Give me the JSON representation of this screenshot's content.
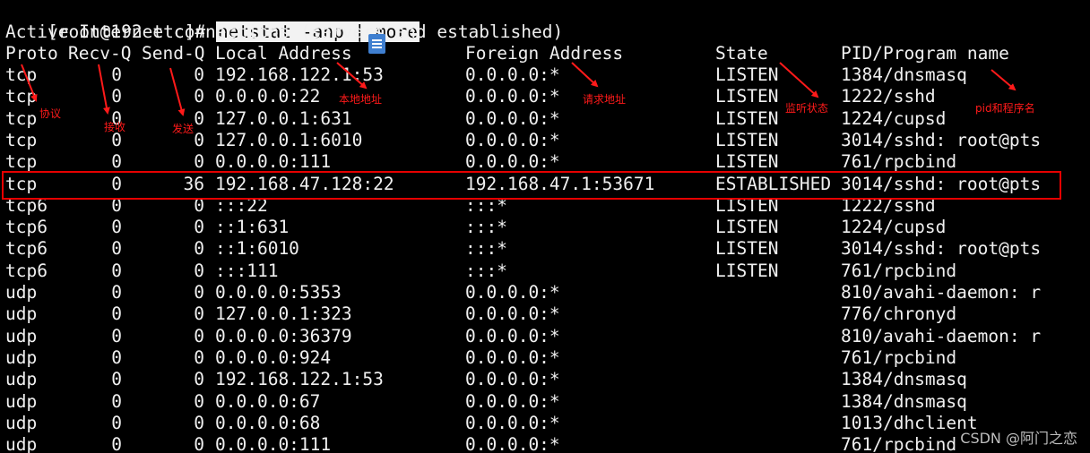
{
  "terminal": {
    "prompt": "[root@192 etc]# ",
    "command": "netstat -anp | more",
    "intro": "Active Internet connections (servers and established)",
    "headers": {
      "proto": "Proto",
      "recvq": "Recv-Q",
      "sendq": "Send-Q",
      "local": "Local Address",
      "foreign": "Foreign Address",
      "state": "State",
      "pid": "PID/Program name"
    },
    "rows": [
      {
        "proto": "tcp",
        "recvq": "0",
        "sendq": "0",
        "local": "192.168.122.1:53",
        "foreign": "0.0.0.0:*",
        "state": "LISTEN",
        "pid": "1384/dnsmasq"
      },
      {
        "proto": "tcp",
        "recvq": "0",
        "sendq": "0",
        "local": "0.0.0.0:22",
        "foreign": "0.0.0.0:*",
        "state": "LISTEN",
        "pid": "1222/sshd"
      },
      {
        "proto": "tcp",
        "recvq": "0",
        "sendq": "0",
        "local": "127.0.0.1:631",
        "foreign": "0.0.0.0:*",
        "state": "LISTEN",
        "pid": "1224/cupsd"
      },
      {
        "proto": "tcp",
        "recvq": "0",
        "sendq": "0",
        "local": "127.0.0.1:6010",
        "foreign": "0.0.0.0:*",
        "state": "LISTEN",
        "pid": "3014/sshd: root@pts"
      },
      {
        "proto": "tcp",
        "recvq": "0",
        "sendq": "0",
        "local": "0.0.0.0:111",
        "foreign": "0.0.0.0:*",
        "state": "LISTEN",
        "pid": "761/rpcbind"
      },
      {
        "proto": "tcp",
        "recvq": "0",
        "sendq": "36",
        "local": "192.168.47.128:22",
        "foreign": "192.168.47.1:53671",
        "state": "ESTABLISHED",
        "pid": "3014/sshd: root@pts"
      },
      {
        "proto": "tcp6",
        "recvq": "0",
        "sendq": "0",
        "local": ":::22",
        "foreign": ":::*",
        "state": "LISTEN",
        "pid": "1222/sshd"
      },
      {
        "proto": "tcp6",
        "recvq": "0",
        "sendq": "0",
        "local": "::1:631",
        "foreign": ":::*",
        "state": "LISTEN",
        "pid": "1224/cupsd"
      },
      {
        "proto": "tcp6",
        "recvq": "0",
        "sendq": "0",
        "local": "::1:6010",
        "foreign": ":::*",
        "state": "LISTEN",
        "pid": "3014/sshd: root@pts"
      },
      {
        "proto": "tcp6",
        "recvq": "0",
        "sendq": "0",
        "local": ":::111",
        "foreign": ":::*",
        "state": "LISTEN",
        "pid": "761/rpcbind"
      },
      {
        "proto": "udp",
        "recvq": "0",
        "sendq": "0",
        "local": "0.0.0.0:5353",
        "foreign": "0.0.0.0:*",
        "state": "",
        "pid": "810/avahi-daemon: r"
      },
      {
        "proto": "udp",
        "recvq": "0",
        "sendq": "0",
        "local": "127.0.0.1:323",
        "foreign": "0.0.0.0:*",
        "state": "",
        "pid": "776/chronyd"
      },
      {
        "proto": "udp",
        "recvq": "0",
        "sendq": "0",
        "local": "0.0.0.0:36379",
        "foreign": "0.0.0.0:*",
        "state": "",
        "pid": "810/avahi-daemon: r"
      },
      {
        "proto": "udp",
        "recvq": "0",
        "sendq": "0",
        "local": "0.0.0.0:924",
        "foreign": "0.0.0.0:*",
        "state": "",
        "pid": "761/rpcbind"
      },
      {
        "proto": "udp",
        "recvq": "0",
        "sendq": "0",
        "local": "192.168.122.1:53",
        "foreign": "0.0.0.0:*",
        "state": "",
        "pid": "1384/dnsmasq"
      },
      {
        "proto": "udp",
        "recvq": "0",
        "sendq": "0",
        "local": "0.0.0.0:67",
        "foreign": "0.0.0.0:*",
        "state": "",
        "pid": "1384/dnsmasq"
      },
      {
        "proto": "udp",
        "recvq": "0",
        "sendq": "0",
        "local": "0.0.0.0:68",
        "foreign": "0.0.0.0:*",
        "state": "",
        "pid": "1013/dhclient"
      },
      {
        "proto": "udp",
        "recvq": "0",
        "sendq": "0",
        "local": "0.0.0.0:111",
        "foreign": "0.0.0.0:*",
        "state": "",
        "pid": "761/rpcbind"
      }
    ]
  },
  "annotations": {
    "protocol": "协议",
    "recv": "接收",
    "send": "发送",
    "local_addr": "本地地址",
    "request_addr": "请求地址",
    "listen_state": "监听状态",
    "pid_program": "pid和程序名"
  },
  "watermark": "CSDN @阿门之恋",
  "colors": {
    "background": "#000000",
    "text": "#f0f0f0",
    "annotation": "#ff1a1a",
    "highlight_box": "#e60000",
    "command_bg": "#f2f2f2"
  },
  "icons": [
    "document-icon"
  ]
}
